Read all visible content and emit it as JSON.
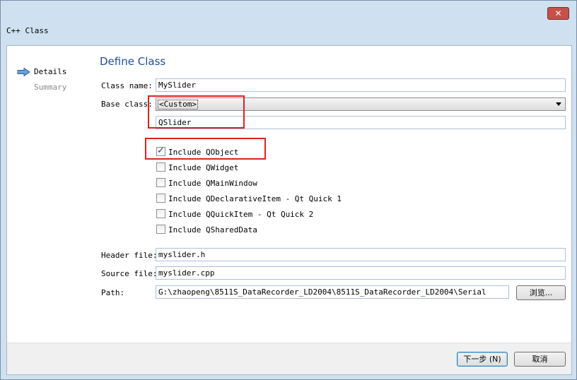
{
  "window": {
    "title": "C++ Class",
    "close_glyph": "✕"
  },
  "sidebar": {
    "items": [
      {
        "label": "Details",
        "active": true
      },
      {
        "label": "Summary",
        "active": false
      }
    ]
  },
  "page": {
    "title": "Define Class"
  },
  "form": {
    "class_name_label": "Class name:",
    "class_name_value": "MySlider",
    "base_class_label": "Base class:",
    "base_class_selected": "<Custom>",
    "custom_base_value": "QSlider",
    "header_file_label": "Header file:",
    "header_file_value": "myslider.h",
    "source_file_label": "Source file:",
    "source_file_value": "myslider.cpp",
    "path_label": "Path:",
    "path_value": "G:\\zhaopeng\\8511S_DataRecorder_LD2004\\8511S_DataRecorder_LD2004\\Serial",
    "browse_label": "浏览..."
  },
  "includes": [
    {
      "label": "Include QObject",
      "checked": true
    },
    {
      "label": "Include QWidget",
      "checked": false
    },
    {
      "label": "Include QMainWindow",
      "checked": false
    },
    {
      "label": "Include QDeclarativeItem - Qt Quick 1",
      "checked": false
    },
    {
      "label": "Include QQuickItem - Qt Quick 2",
      "checked": false
    },
    {
      "label": "Include QSharedData",
      "checked": false
    }
  ],
  "footer": {
    "next_label": "下一步 (N)",
    "cancel_label": "取消"
  },
  "colors": {
    "accent_title": "#1f4f98",
    "highlight": "#e02020",
    "close_button": "#c7504a"
  }
}
